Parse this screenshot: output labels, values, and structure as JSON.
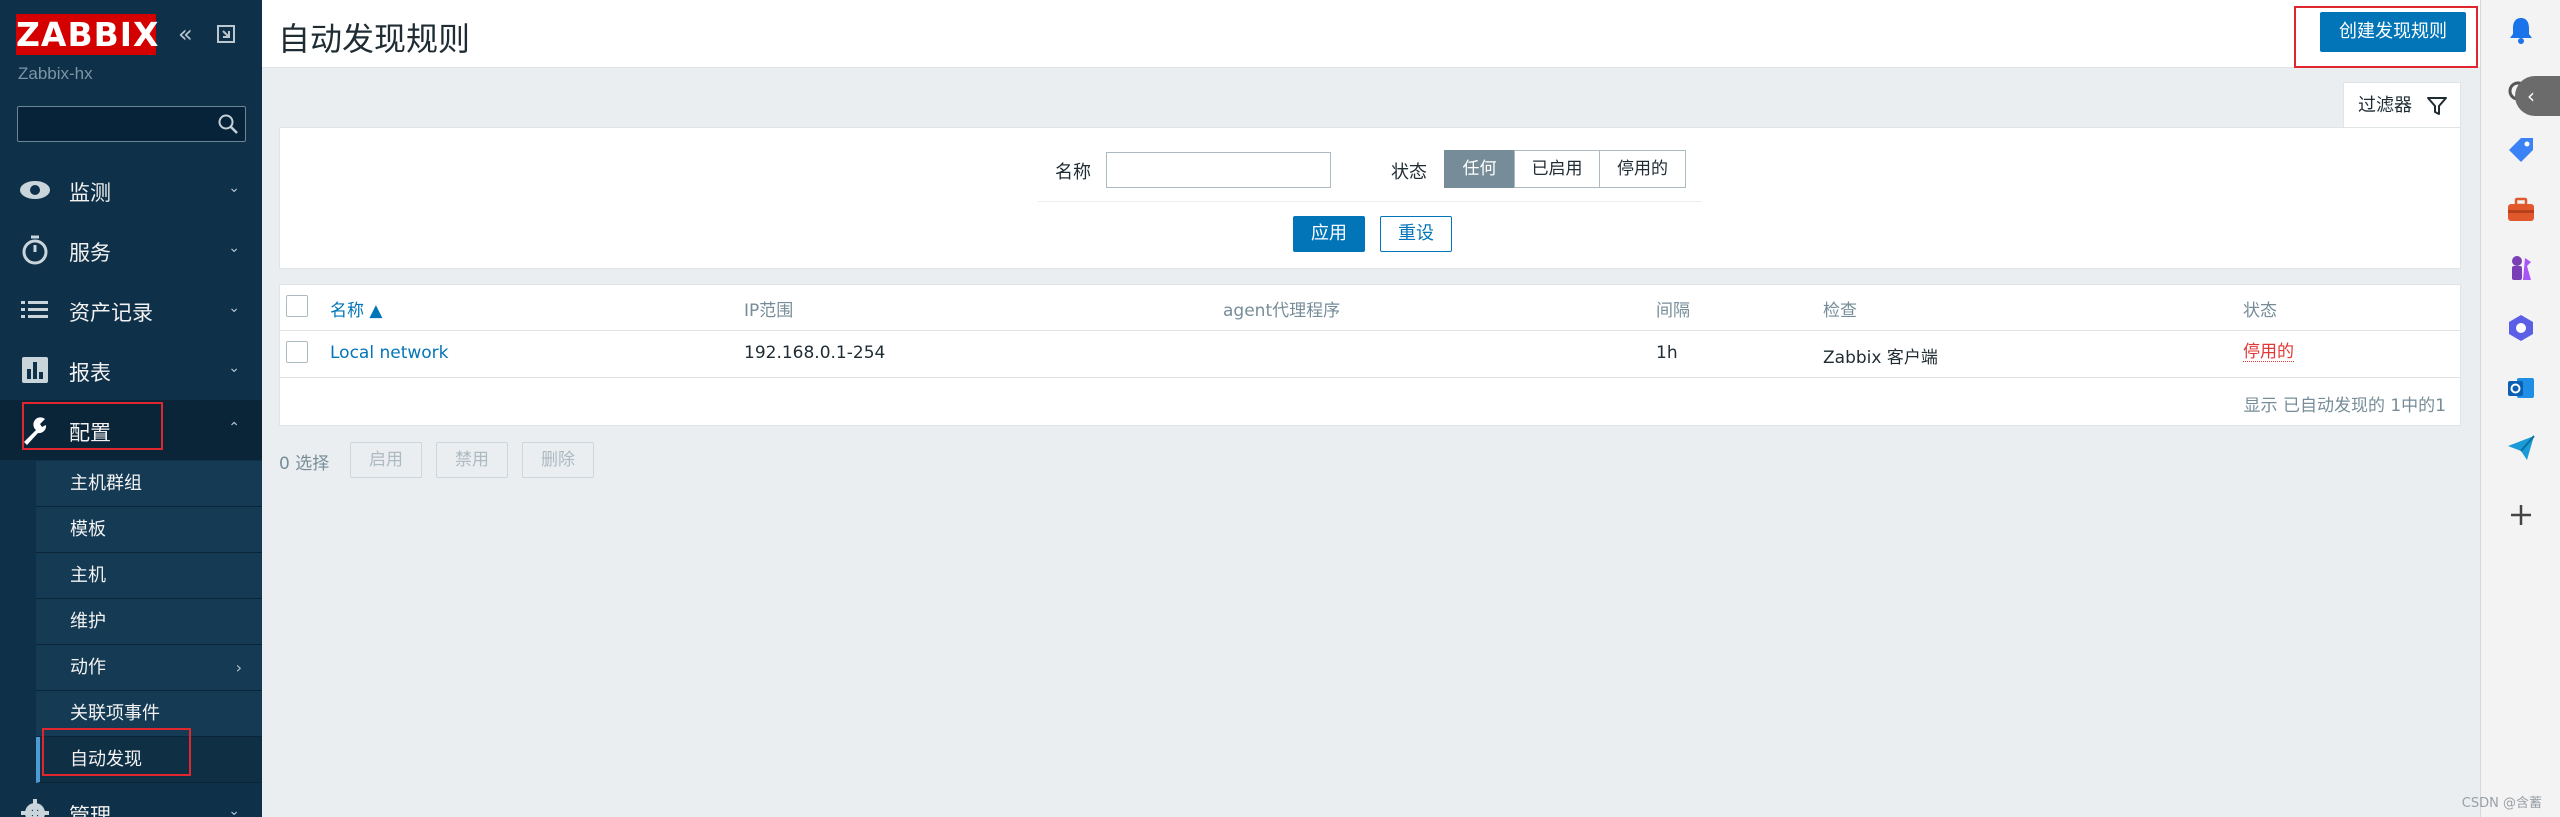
{
  "app": {
    "logo_text": "ZABBIX",
    "hostname": "Zabbix-hx"
  },
  "sidebar": {
    "search_value": "",
    "menu": [
      {
        "label": "监测",
        "icon": "eye-icon",
        "expanded": false
      },
      {
        "label": "服务",
        "icon": "stopwatch-icon",
        "expanded": false
      },
      {
        "label": "资产记录",
        "icon": "list-icon",
        "expanded": false
      },
      {
        "label": "报表",
        "icon": "bar-chart-icon",
        "expanded": false
      },
      {
        "label": "配置",
        "icon": "wrench-icon",
        "expanded": true
      },
      {
        "label": "管理",
        "icon": "gear-icon",
        "expanded": false
      }
    ],
    "submenu": [
      {
        "label": "主机群组"
      },
      {
        "label": "模板"
      },
      {
        "label": "主机"
      },
      {
        "label": "维护"
      },
      {
        "label": "动作",
        "has_children": true
      },
      {
        "label": "关联项事件"
      },
      {
        "label": "自动发现",
        "selected": true
      }
    ]
  },
  "header": {
    "title": "自动发现规则",
    "create_button": "创建发现规则"
  },
  "filter": {
    "tab_label": "过滤器",
    "name_label": "名称",
    "name_value": "",
    "status_label": "状态",
    "status_options": [
      "任何",
      "已启用",
      "停用的"
    ],
    "status_selected": "任何",
    "apply_label": "应用",
    "reset_label": "重设"
  },
  "table": {
    "columns": [
      "名称 ▲",
      "IP范围",
      "agent代理程序",
      "间隔",
      "检查",
      "状态"
    ],
    "rows": [
      {
        "name": "Local network",
        "ip_range": "192.168.0.1-254",
        "proxy": "",
        "interval": "1h",
        "checks": "Zabbix 客户端",
        "status": "停用的"
      }
    ],
    "footer": "显示 已自动发现的 1中的1"
  },
  "actions": {
    "selected_count": "0 选择",
    "buttons": [
      "启用",
      "禁用",
      "删除"
    ]
  },
  "right_rail": {
    "icons": [
      "bell-icon",
      "search-icon",
      "tag-icon",
      "toolbox-icon",
      "chess-icon",
      "copilot-icon",
      "outlook-icon",
      "send-icon",
      "plus-icon"
    ]
  },
  "watermark": "CSDN @含蓄"
}
